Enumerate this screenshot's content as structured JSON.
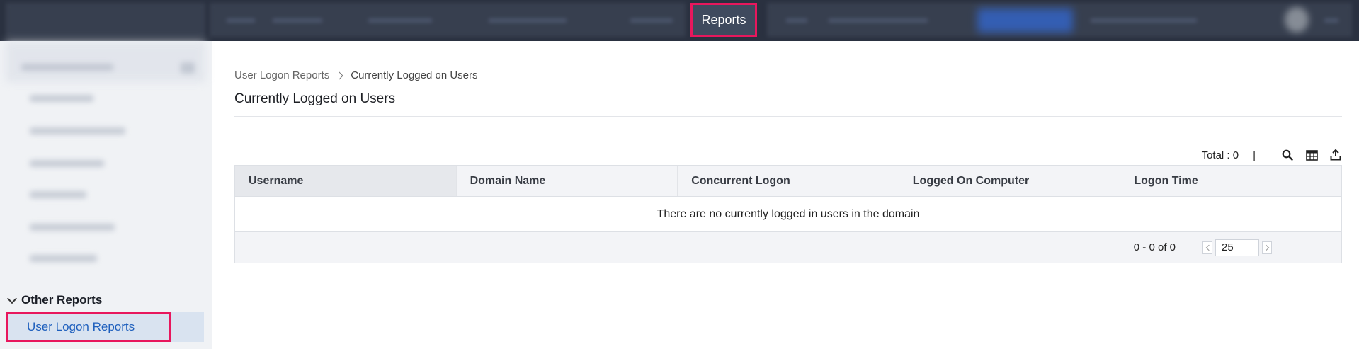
{
  "topbar": {
    "active_tab": "Reports"
  },
  "sidebar": {
    "section_title": "Other Reports",
    "active_item": "User Logon Reports"
  },
  "breadcrumb": {
    "parent": "User Logon Reports",
    "current": "Currently Logged on Users"
  },
  "page": {
    "title": "Currently Logged on Users"
  },
  "toolbar": {
    "total_label": "Total : 0",
    "separator": "|",
    "icons": [
      "search-icon",
      "column-chooser-icon",
      "export-icon"
    ]
  },
  "grid": {
    "columns": [
      "Username",
      "Domain Name",
      "Concurrent Logon",
      "Logged On Computer",
      "Logon Time"
    ],
    "empty_message": "There are no currently logged in users in the domain",
    "pager_range": "0 - 0 of 0",
    "page_size": "25"
  },
  "colors": {
    "topbar_bg": "#2a3140",
    "highlight_border": "#e8175d",
    "link_blue": "#1e5fbd",
    "sidebar_bg": "#f0f2f5"
  }
}
